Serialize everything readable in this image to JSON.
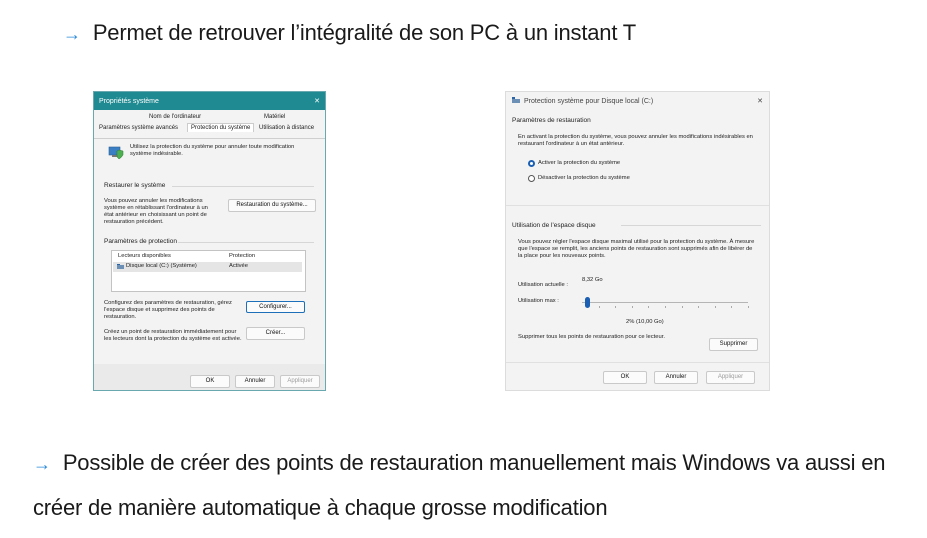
{
  "bullet1": {
    "arrow": "→",
    "text": "Permet de retrouver l’intégralité de son PC à un instant T"
  },
  "bullet2": {
    "arrow": "→",
    "text": "Possible de créer des points de restauration manuellement mais Windows va aussi en créer de manière automatique à chaque grosse modification"
  },
  "dialog1": {
    "title": "Propriétés système",
    "close": "✕",
    "tabs_top": [
      "Nom de l'ordinateur",
      "Matériel"
    ],
    "tabs_bottom": [
      "Paramètres système avancés",
      "Protection du système",
      "Utilisation à distance"
    ],
    "intro": "Utilisez la protection du système pour annuler toute modification système indésirable.",
    "restore_section": "Restaurer le système",
    "restore_text": "Vous pouvez annuler les modifications système en rétablissant l'ordinateur à un état antérieur en choisissant un point de restauration précédent.",
    "restore_button": "Restauration du système...",
    "protection_section": "Paramètres de protection",
    "col_drives": "Lecteurs disponibles",
    "col_protection": "Protection",
    "drive_name": "Disque local (C:) (Système)",
    "drive_status": "Activée",
    "configure_text": "Configurez des paramètres de restauration, gérez l'espace disque et supprimez des points de restauration.",
    "configure_button": "Configurer...",
    "create_text": "Créez un point de restauration immédiatement pour les lecteurs dont la protection du système est activée.",
    "create_button": "Créer...",
    "ok": "OK",
    "cancel": "Annuler",
    "apply": "Appliquer"
  },
  "dialog2": {
    "title": "Protection système pour Disque local (C:)",
    "close": "✕",
    "restore_params": "Paramètres de restauration",
    "restore_desc": "En activant la protection du système, vous pouvez annuler les modifications indésirables en restaurant l'ordinateur à un état antérieur.",
    "radio_on": "Activer la protection du système",
    "radio_off": "Désactiver la protection du système",
    "disk_usage": "Utilisation de l'espace disque",
    "disk_desc": "Vous pouvez régler l'espace disque maximal utilisé pour la protection du système. À mesure que l'espace se remplit, les anciens points de restauration sont supprimés afin de libérer de la place pour les nouveaux points.",
    "current_label": "Utilisation actuelle :",
    "current_value": "8,32 Go",
    "max_label": "Utilisation max :",
    "slider_value": "2% (10,00 Go)",
    "slider_fraction": 0.02,
    "delete_text": "Supprimer tous les points de restauration pour ce lecteur.",
    "delete_button": "Supprimer",
    "ok": "OK",
    "cancel": "Annuler",
    "apply": "Appliquer"
  }
}
